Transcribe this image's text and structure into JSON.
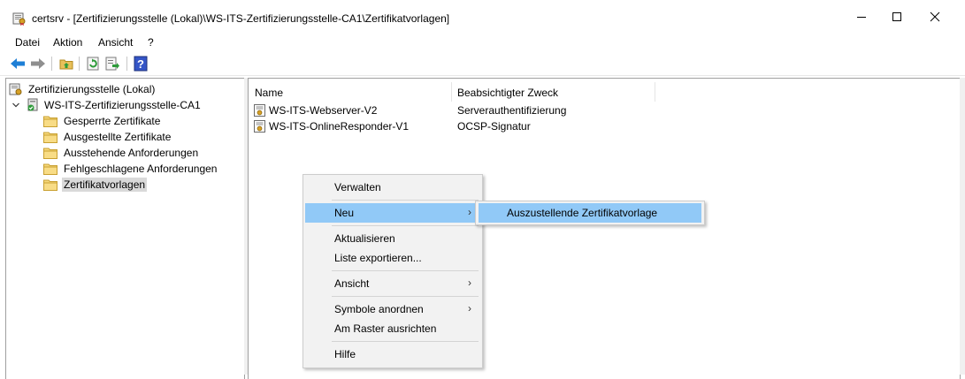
{
  "window": {
    "title": "certsrv - [Zertifizierungsstelle (Lokal)\\WS-ITS-Zertifizierungsstelle-CA1\\Zertifikatvorlagen]"
  },
  "menubar": {
    "items": [
      "Datei",
      "Aktion",
      "Ansicht",
      "?"
    ]
  },
  "tree": {
    "root": "Zertifizierungsstelle (Lokal)",
    "ca": "WS-ITS-Zertifizierungsstelle-CA1",
    "folders": [
      "Gesperrte Zertifikate",
      "Ausgestellte Zertifikate",
      "Ausstehende Anforderungen",
      "Fehlgeschlagene Anforderungen",
      "Zertifikatvorlagen"
    ],
    "selected": "Zertifikatvorlagen"
  },
  "list": {
    "columns": [
      "Name",
      "Beabsichtigter Zweck"
    ],
    "rows": [
      {
        "name": "WS-ITS-Webserver-V2",
        "purpose": "Serverauthentifizierung"
      },
      {
        "name": "WS-ITS-OnlineResponder-V1",
        "purpose": "OCSP-Signatur"
      }
    ]
  },
  "context_menu": {
    "items": [
      {
        "label": "Verwalten"
      },
      {
        "label": "Neu",
        "submenu": true,
        "highlighted": true
      },
      {
        "label": "Aktualisieren"
      },
      {
        "label": "Liste exportieren..."
      },
      {
        "label": "Ansicht",
        "submenu": true
      },
      {
        "label": "Symbole anordnen",
        "submenu": true
      },
      {
        "label": "Am Raster ausrichten"
      },
      {
        "label": "Hilfe"
      }
    ],
    "submenu_arrow": "›"
  },
  "submenu": {
    "items": [
      "Auszustellende Zertifikatvorlage"
    ]
  },
  "colors": {
    "highlight": "#91c9f7",
    "back_arrow": "#1e7fd6"
  }
}
